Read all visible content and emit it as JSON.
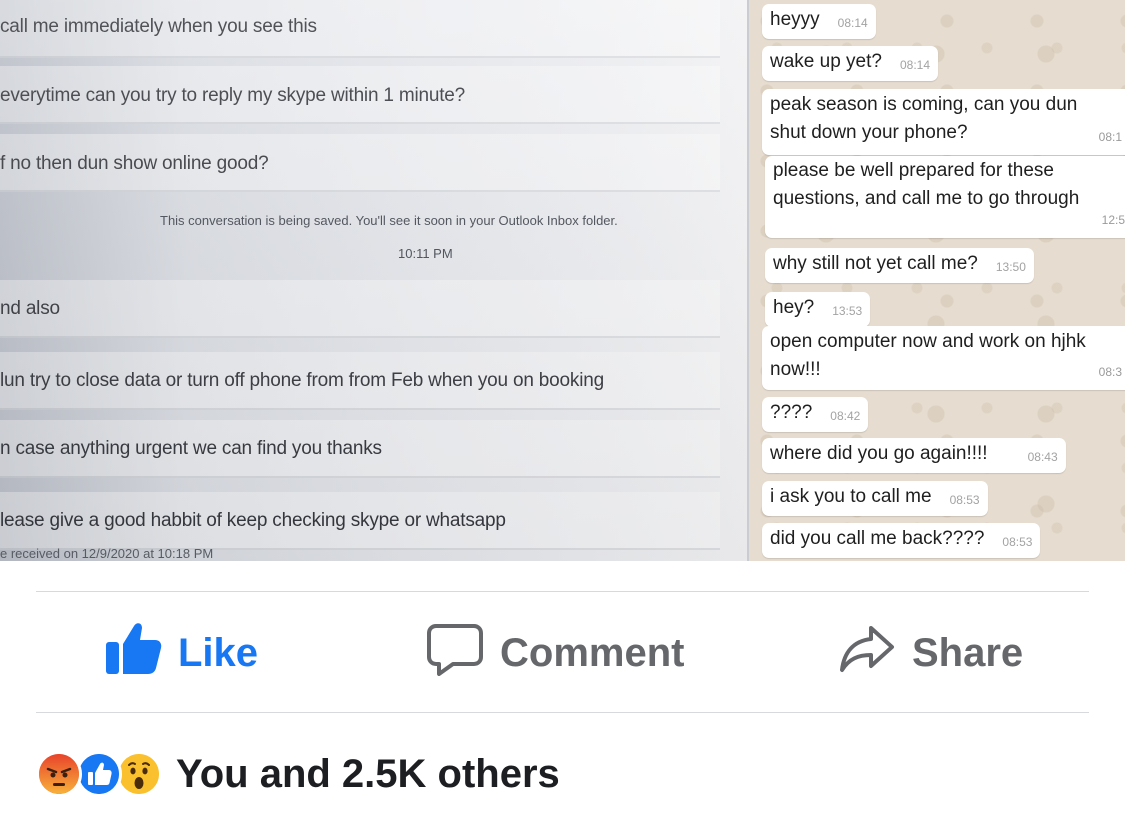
{
  "photo": {
    "skype": {
      "messages": [
        "call me immediately when you see this",
        "everytime can you try to reply my skype within 1 minute?",
        "f no then dun show online good?",
        "nd also",
        "lun try to close data or turn off phone from from Feb when you on booking",
        "n case anything urgent we can find you thanks",
        "lease give a good habbit of keep checking skype or whatsapp"
      ],
      "saved_notice": "This conversation is being saved. You'll see it soon in your Outlook Inbox folder.",
      "notice_time": "10:11 PM",
      "received_line": "e received on 12/9/2020 at 10:18 PM"
    },
    "whatsapp": {
      "bubbles": [
        {
          "text": "heyyy",
          "time": "08:14"
        },
        {
          "text": "wake up yet?",
          "time": "08:14"
        },
        {
          "line1": "peak season is coming, can you dun",
          "line2": "shut down your phone?",
          "time": "08:1"
        },
        {
          "line1": "please be well prepared for these",
          "line2": "questions, and call me to go through",
          "time": "12:5"
        },
        {
          "text": "why still not yet call me?",
          "time": "13:50"
        },
        {
          "text": "hey?",
          "time": "13:53"
        },
        {
          "line1": "open computer now and work on hjhk",
          "line2": "now!!!",
          "time": "08:3"
        },
        {
          "text": "????",
          "time": "08:42"
        },
        {
          "text": "where did you go again!!!!",
          "time": "08:43"
        },
        {
          "text": "i ask you to call me",
          "time": "08:53"
        },
        {
          "text": "did you call me back????",
          "time": "08:53"
        }
      ]
    }
  },
  "actions": {
    "like_label": "Like",
    "comment_label": "Comment",
    "share_label": "Share",
    "like_icon": "thumbs-up-icon",
    "comment_icon": "speech-bubble-icon",
    "share_icon": "share-arrow-icon"
  },
  "reactions": {
    "summary": "You and 2.5K others",
    "types": [
      "angry",
      "like",
      "wow"
    ]
  },
  "colors": {
    "facebook_blue": "#1877f2",
    "action_gray": "#65676b",
    "angry": "#f0623a",
    "wow": "#fbc02d"
  }
}
